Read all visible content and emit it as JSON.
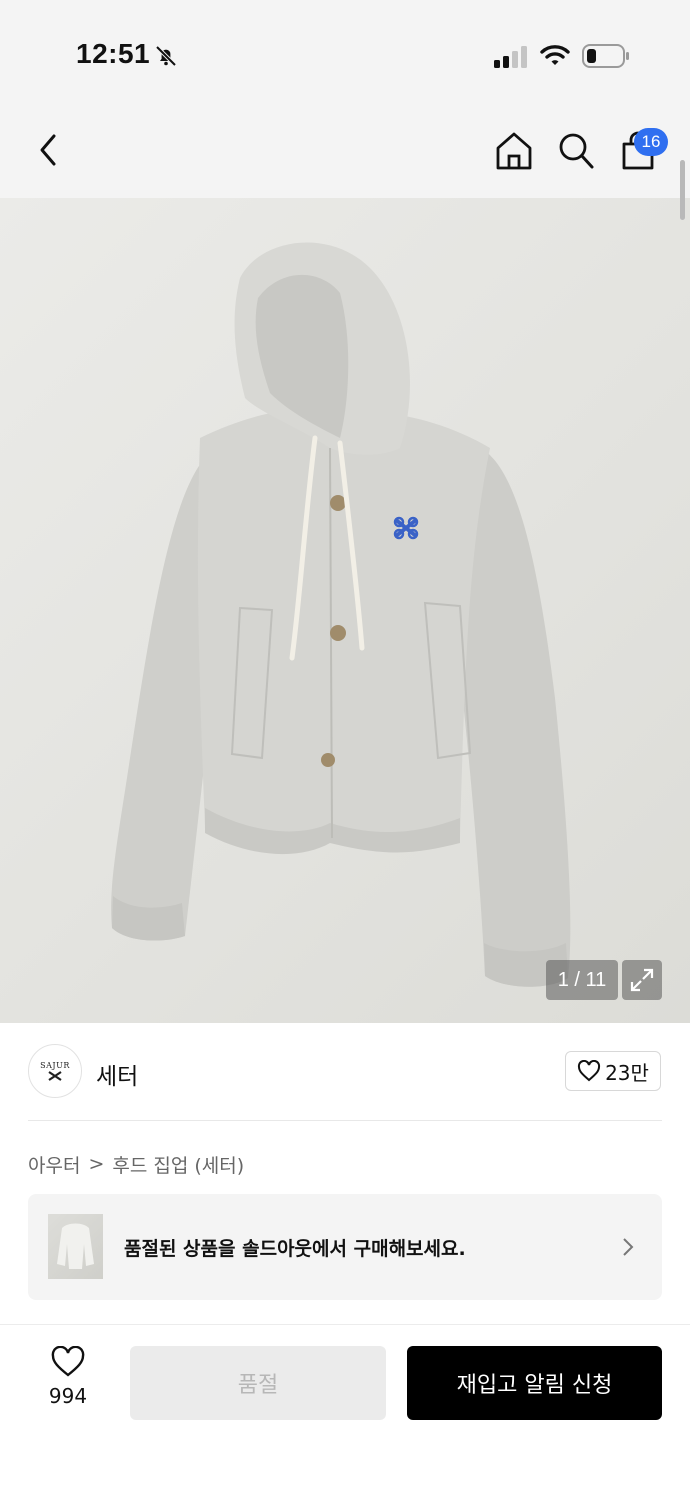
{
  "status_bar": {
    "time": "12:51"
  },
  "nav": {
    "cart_count": "16"
  },
  "gallery": {
    "counter": "1 / 11"
  },
  "brand": {
    "logo_text": "SAJUR",
    "name": "세터",
    "like_count": "23만"
  },
  "breadcrumb": {
    "level1": "아우터",
    "separator": ">",
    "level2": "후드 집업 (세터)"
  },
  "soldout_banner": {
    "text": "품절된 상품을 솔드아웃에서 구매해보세요."
  },
  "bottom_bar": {
    "wish_count": "994",
    "soldout_label": "품절",
    "restock_label": "재입고 알림 신청"
  },
  "colors": {
    "accent_badge": "#2f6ff0",
    "primary_button": "#000000",
    "disabled_button": "#ebebeb"
  }
}
